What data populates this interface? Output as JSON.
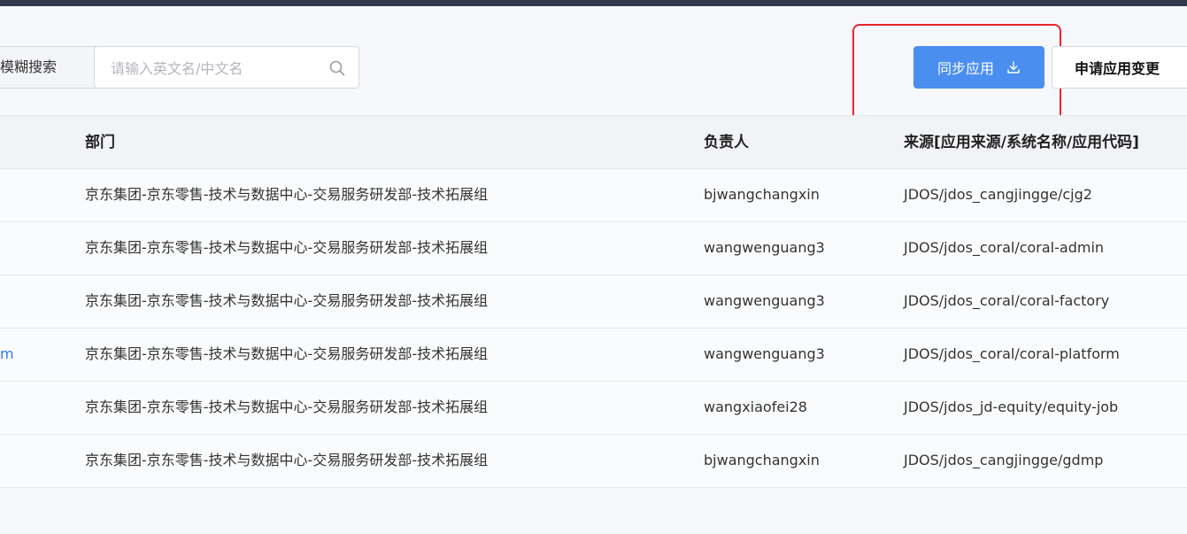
{
  "search": {
    "mode_label": "模糊搜索",
    "placeholder": "请输入英文名/中文名",
    "value": ""
  },
  "toolbar": {
    "sync_label": "同步应用",
    "change_label": "申请应用变更"
  },
  "table": {
    "columns": {
      "department": "部门",
      "owner": "负责人",
      "source": "来源[应用来源/系统名称/应用代码]"
    },
    "rows": [
      {
        "name_fragment": "",
        "department": "京东集团-京东零售-技术与数据中心-交易服务研发部-技术拓展组",
        "owner": "bjwangchangxin",
        "source": "JDOS/jdos_cangjingge/cjg2"
      },
      {
        "name_fragment": "",
        "department": "京东集团-京东零售-技术与数据中心-交易服务研发部-技术拓展组",
        "owner": "wangwenguang3",
        "source": "JDOS/jdos_coral/coral-admin"
      },
      {
        "name_fragment": "",
        "department": "京东集团-京东零售-技术与数据中心-交易服务研发部-技术拓展组",
        "owner": "wangwenguang3",
        "source": "JDOS/jdos_coral/coral-factory"
      },
      {
        "name_fragment": "m",
        "department": "京东集团-京东零售-技术与数据中心-交易服务研发部-技术拓展组",
        "owner": "wangwenguang3",
        "source": "JDOS/jdos_coral/coral-platform"
      },
      {
        "name_fragment": "",
        "department": "京东集团-京东零售-技术与数据中心-交易服务研发部-技术拓展组",
        "owner": "wangxiaofei28",
        "source": "JDOS/jdos_jd-equity/equity-job"
      },
      {
        "name_fragment": "",
        "department": "京东集团-京东零售-技术与数据中心-交易服务研发部-技术拓展组",
        "owner": "bjwangchangxin",
        "source": "JDOS/jdos_cangjingge/gdmp"
      }
    ]
  },
  "colors": {
    "primary": "#4a8ef0",
    "highlight": "#e8262a",
    "link": "#3478f6",
    "top_bar": "#2f3a4d"
  },
  "icons": {
    "search": "search-icon",
    "sync": "download-icon"
  }
}
